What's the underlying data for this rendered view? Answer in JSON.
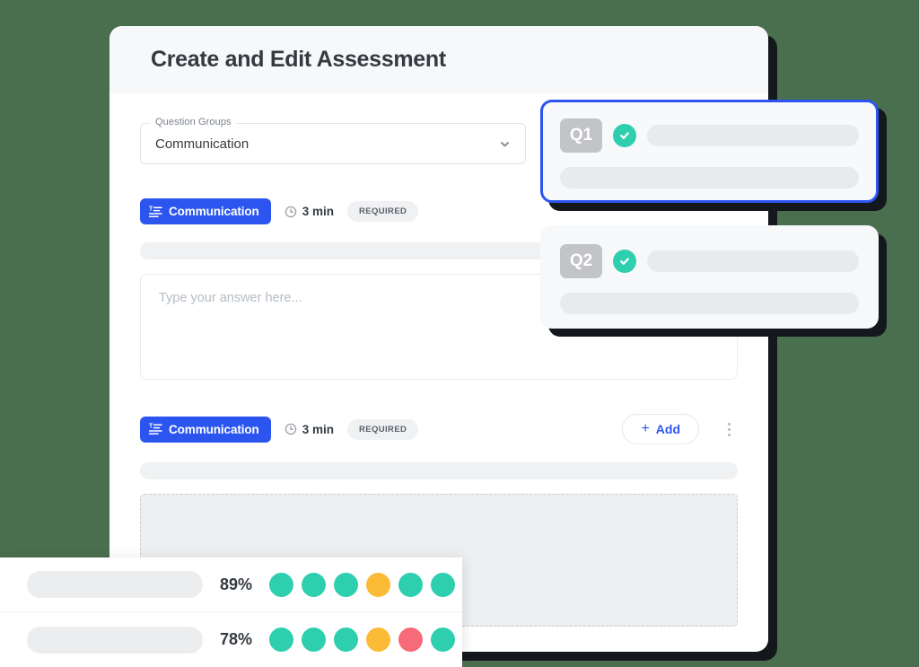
{
  "window": {
    "title": "Create and Edit Assessment"
  },
  "question_groups": {
    "label": "Question Groups",
    "value": "Communication",
    "chevron_icon": "chevron-down-icon"
  },
  "questions": [
    {
      "tag": "Communication",
      "tag_icon": "text-list-icon",
      "duration": "3 min",
      "duration_icon": "clock-icon",
      "required_label": "REQUIRED",
      "answer_placeholder": "Type your answer here..."
    },
    {
      "tag": "Communication",
      "tag_icon": "text-list-icon",
      "duration": "3 min",
      "duration_icon": "clock-icon",
      "required_label": "REQUIRED",
      "add_label": "Add",
      "add_plus": "+",
      "menu_icon": "kebab-menu-icon"
    }
  ],
  "question_cards": [
    {
      "badge": "Q1",
      "status_icon": "check-circle-icon",
      "selected": true
    },
    {
      "badge": "Q2",
      "status_icon": "check-circle-icon",
      "selected": false
    }
  ],
  "scores": [
    {
      "percent": "89%",
      "dots": [
        "#2ecfae",
        "#2ecfae",
        "#2ecfae",
        "#fbbb36",
        "#2ecfae",
        "#2ecfae"
      ]
    },
    {
      "percent": "78%",
      "dots": [
        "#2ecfae",
        "#2ecfae",
        "#2ecfae",
        "#fbbb36",
        "#f66a7a",
        "#2ecfae"
      ]
    }
  ],
  "colors": {
    "background": "#4a6f4f",
    "accent_blue": "#2b55ee",
    "teal": "#2ecfae",
    "amber": "#fbbb36",
    "red": "#f66a7a",
    "shadow": "#14181c"
  }
}
